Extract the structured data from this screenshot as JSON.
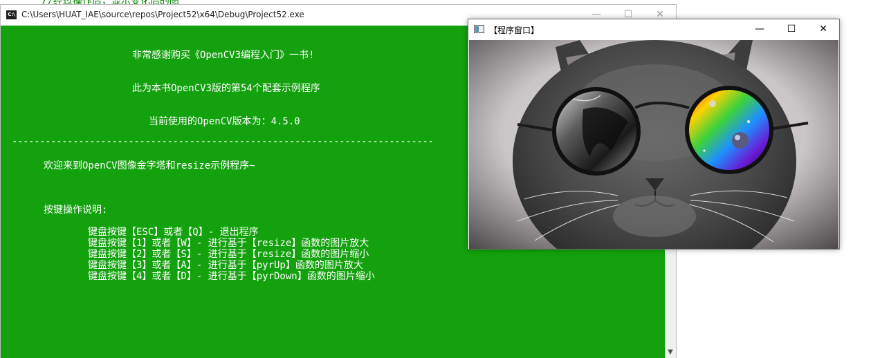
{
  "ide": {
    "code_line": "//经过操作后，显示变化后的图"
  },
  "console_window": {
    "title": "C:\\Users\\HUAT_IAE\\source\\repos\\Project52\\x64\\Debug\\Project52.exe",
    "icon_text": "C:\\",
    "min_glyph": "—",
    "max_glyph": "☐",
    "close_glyph": "✕",
    "scroll_down_glyph": "▼",
    "background_color": "#13a10e",
    "text_color": "#ffffff",
    "lines": {
      "thanks": "非常感谢购买《OpenCV3编程入门》一书!",
      "sample_info": "此为本书OpenCV3版的第54个配套示例程序",
      "version": "当前使用的OpenCV版本为：4.5.0",
      "divider": "----------------------------------------------------------------------------",
      "welcome": "欢迎来到OpenCV图像金字塔和resize示例程序~",
      "instructions_header": "按键操作说明:",
      "instructions": [
        "键盘按键【ESC】或者【Q】- 退出程序",
        "键盘按键【1】或者【W】- 进行基于【resize】函数的图片放大",
        "键盘按键【2】或者【S】- 进行基于【resize】函数的图片缩小",
        "键盘按键【3】或者【A】- 进行基于【pyrUp】函数的图片放大",
        "键盘按键【4】或者【D】- 进行基于【pyrDown】函数的图片缩小"
      ]
    }
  },
  "image_window": {
    "title": "【程序窗口】",
    "min_glyph": "—",
    "max_glyph": "☐",
    "close_glyph": "✕",
    "image_subject": "grey cat wearing round sunglasses"
  }
}
